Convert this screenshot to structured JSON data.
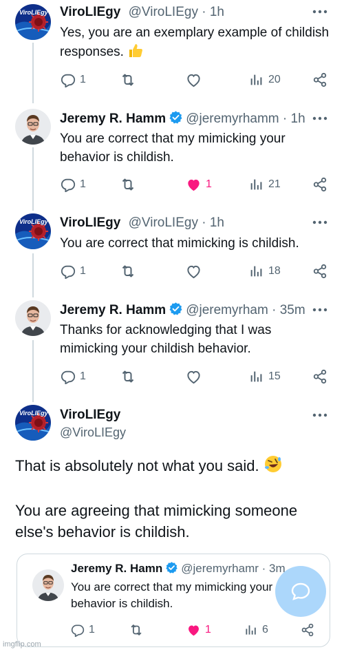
{
  "tweets": [
    {
      "name": "ViroLIEgy",
      "handle": "@ViroLIEgy",
      "dot": " · ",
      "time": "1h",
      "text": "Yes, you are an exemplary example of childish responses.",
      "replies": "1",
      "likes": "",
      "views": "20"
    },
    {
      "name": "Jeremy R. Hamm",
      "handle": "@jeremyrhamm",
      "dot": " · ",
      "time": "1h",
      "text": "You are correct that my mimicking your behavior is childish.",
      "replies": "1",
      "likes": "1",
      "views": "21"
    },
    {
      "name": "ViroLIEgy",
      "handle": "@ViroLIEgy",
      "dot": " · ",
      "time": "1h",
      "text": "You are correct that mimicking is childish.",
      "replies": "1",
      "likes": "",
      "views": "18"
    },
    {
      "name": "Jeremy R. Hamm",
      "handle": "@jeremyrham",
      "dot": " · ",
      "time": "35m",
      "text": "Thanks for acknowledging that I was mimicking your childish behavior.",
      "replies": "1",
      "likes": "",
      "views": "15"
    }
  ],
  "focus": {
    "name": "ViroLIEgy",
    "handle": "@ViroLIEgy",
    "paragraph1": "That is absolutely not what you said.",
    "paragraph2": "You are agreeing that mimicking someone else's behavior is childish."
  },
  "quote": {
    "name": "Jeremy R. Hamn",
    "handle": "@jeremyrhamr",
    "dot": " · ",
    "time": "3m",
    "text": "You are correct that my mimicking your behavior is childish.",
    "replies": "1",
    "likes": "1",
    "views": "6"
  },
  "avatar_logo_text": "ViroLIEgy",
  "watermark": "imgflip.com",
  "icons": {
    "reply": "reply-icon",
    "retweet": "retweet-icon",
    "like": "heart-icon",
    "views": "views-icon",
    "share": "share-icon",
    "more": "more-icon",
    "verified": "verified-badge-icon",
    "thumbs": "thumbs-up-emoji",
    "laugh": "rolling-laughing-emoji",
    "compose": "compose-bubble-icon"
  },
  "colors": {
    "accent": "#1d9bf0",
    "like": "#f91880",
    "muted": "#536471",
    "line": "#cfd9de"
  }
}
